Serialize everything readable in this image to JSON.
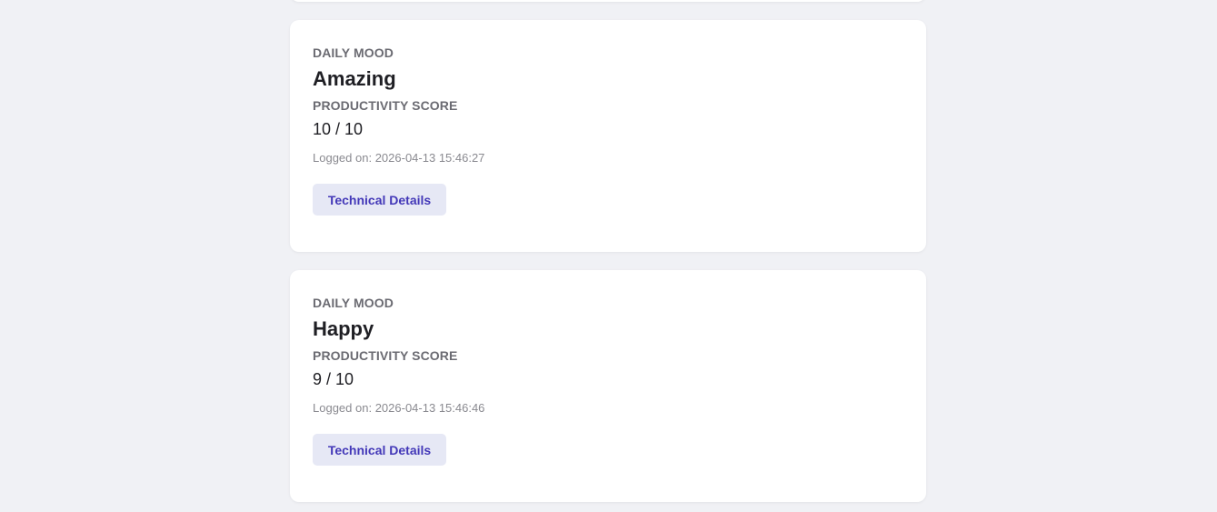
{
  "entries": [
    {
      "mood_label": "DAILY MOOD",
      "mood": "Amazing",
      "score_label": "PRODUCTIVITY SCORE",
      "score": "10",
      "score_sep": "/",
      "score_max": "10",
      "logged_prefix": "Logged on:",
      "logged_at": "2026-04-13 15:46:27",
      "button_label": "Technical Details"
    },
    {
      "mood_label": "DAILY MOOD",
      "mood": "Happy",
      "score_label": "PRODUCTIVITY SCORE",
      "score": "9",
      "score_sep": "/",
      "score_max": "10",
      "logged_prefix": "Logged on:",
      "logged_at": "2026-04-13 15:46:46",
      "button_label": "Technical Details"
    }
  ],
  "colors": {
    "page_background": "#f0f1f5",
    "card_background": "#ffffff",
    "label_text": "#6b6b72",
    "value_text": "#1f1f24",
    "timestamp_text": "#8a8a90",
    "button_background": "#e6e8f5",
    "button_text": "#4338b8"
  }
}
